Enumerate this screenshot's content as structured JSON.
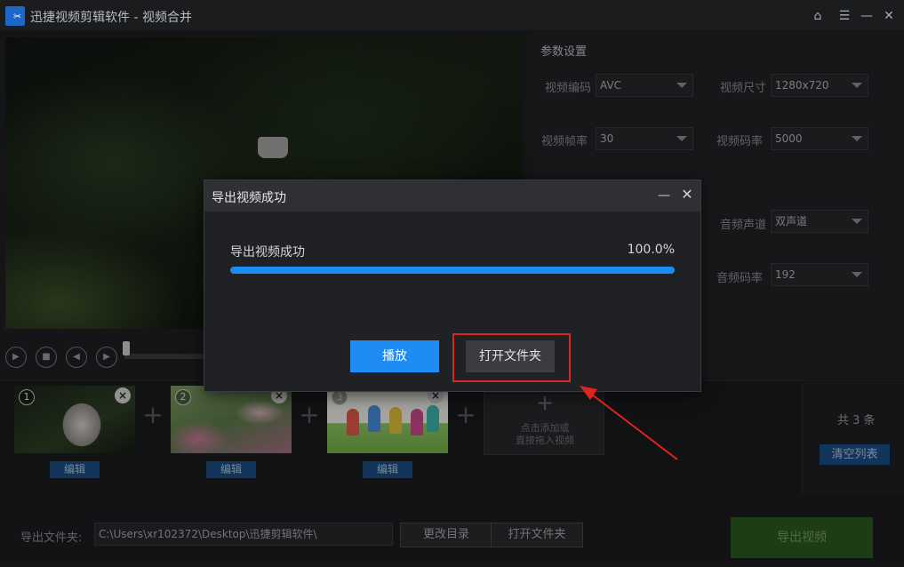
{
  "window": {
    "title": "迅捷视频剪辑软件 - 视频合并",
    "controls": {
      "home": "⌂",
      "menu": "☰",
      "minimize": "—",
      "close": "✕"
    }
  },
  "params": {
    "title": "参数设置",
    "video_codec": {
      "label": "视频编码",
      "value": "AVC"
    },
    "video_size": {
      "label": "视频尺寸",
      "value": "1280x720"
    },
    "frame_rate": {
      "label": "视频帧率",
      "value": "30"
    },
    "video_bitrate": {
      "label": "视频码率",
      "value": "5000"
    },
    "audio_channels": {
      "label": "音频声道",
      "value": "双声道"
    },
    "audio_bitrate": {
      "label": "音频码率",
      "value": "192"
    }
  },
  "player": {
    "icons": [
      "play-icon",
      "stop-icon",
      "prev-frame-icon",
      "next-frame-icon"
    ]
  },
  "clips": [
    {
      "num": "1",
      "edit_label": "编辑"
    },
    {
      "num": "2",
      "edit_label": "编辑"
    },
    {
      "num": "3",
      "edit_label": "编辑"
    }
  ],
  "add_clip": {
    "plus": "+",
    "line1": "点击添加或",
    "line2": "直接拖入视频"
  },
  "list": {
    "count_text": "共 3 条",
    "clear_label": "清空列表"
  },
  "bottom": {
    "output_label": "导出文件夹:",
    "output_path": "C:\\Users\\xr102372\\Desktop\\迅捷剪辑软件\\",
    "change_dir_label": "更改目录",
    "open_folder_label": "打开文件夹",
    "export_label": "导出视频"
  },
  "dialog": {
    "title": "导出视频成功",
    "status": "导出视频成功",
    "progress_text": "100.0%",
    "progress": 1.0,
    "play_label": "播放",
    "open_folder_label": "打开文件夹"
  },
  "colors": {
    "accent": "#1e8cf4",
    "highlight": "#e0231f",
    "export_green": "#2c5a1e"
  }
}
